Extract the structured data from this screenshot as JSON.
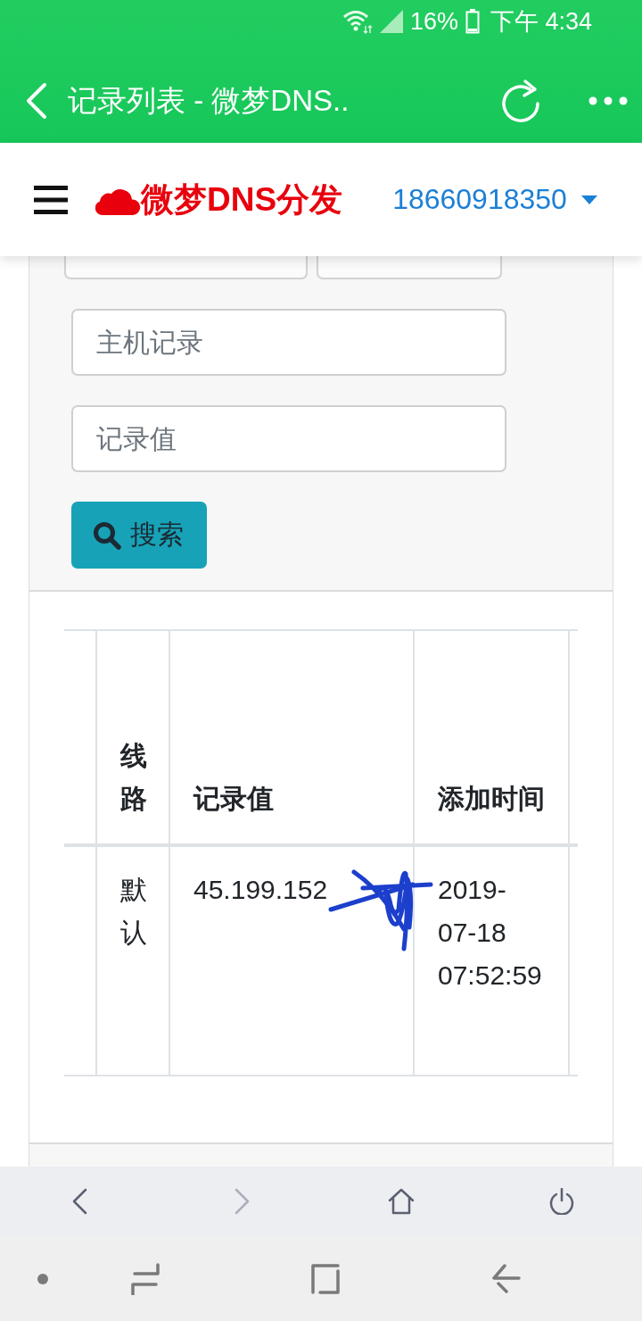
{
  "status_bar": {
    "battery": "16%",
    "time": "下午 4:34"
  },
  "app_bar": {
    "title": "记录列表 - 微梦DNS.."
  },
  "site_header": {
    "brand": "微梦DNS分发",
    "account": "18660918350"
  },
  "filters": [
    {
      "kind": "select"
    },
    {
      "kind": "select"
    },
    {
      "kind": "text",
      "placeholder": "主机记录"
    },
    {
      "kind": "text",
      "placeholder": "记录值"
    }
  ],
  "search_button": {
    "label": "搜索"
  },
  "table": {
    "columns": [
      {
        "kind": "clipped"
      },
      {
        "kind": "text",
        "label": "线路"
      },
      {
        "kind": "text",
        "label": "记录值"
      },
      {
        "kind": "text",
        "label": "添加时间"
      },
      {
        "kind": "clipped"
      }
    ],
    "rows": [
      {
        "cells": [
          {
            "kind": "clipped"
          },
          {
            "kind": "text",
            "text": "默认",
            "redacted": false
          },
          {
            "kind": "text",
            "text": "45.199.152",
            "redacted": true
          },
          {
            "kind": "date",
            "text": "2019-07-18 07:52:59",
            "redacted": false
          },
          {
            "kind": "clipped"
          }
        ]
      }
    ]
  },
  "browser_toolbar": {
    "buttons": [
      {
        "kind": "back",
        "disabled": false
      },
      {
        "kind": "forward",
        "disabled": true
      },
      {
        "kind": "home",
        "disabled": false
      },
      {
        "kind": "power",
        "disabled": false
      }
    ]
  }
}
